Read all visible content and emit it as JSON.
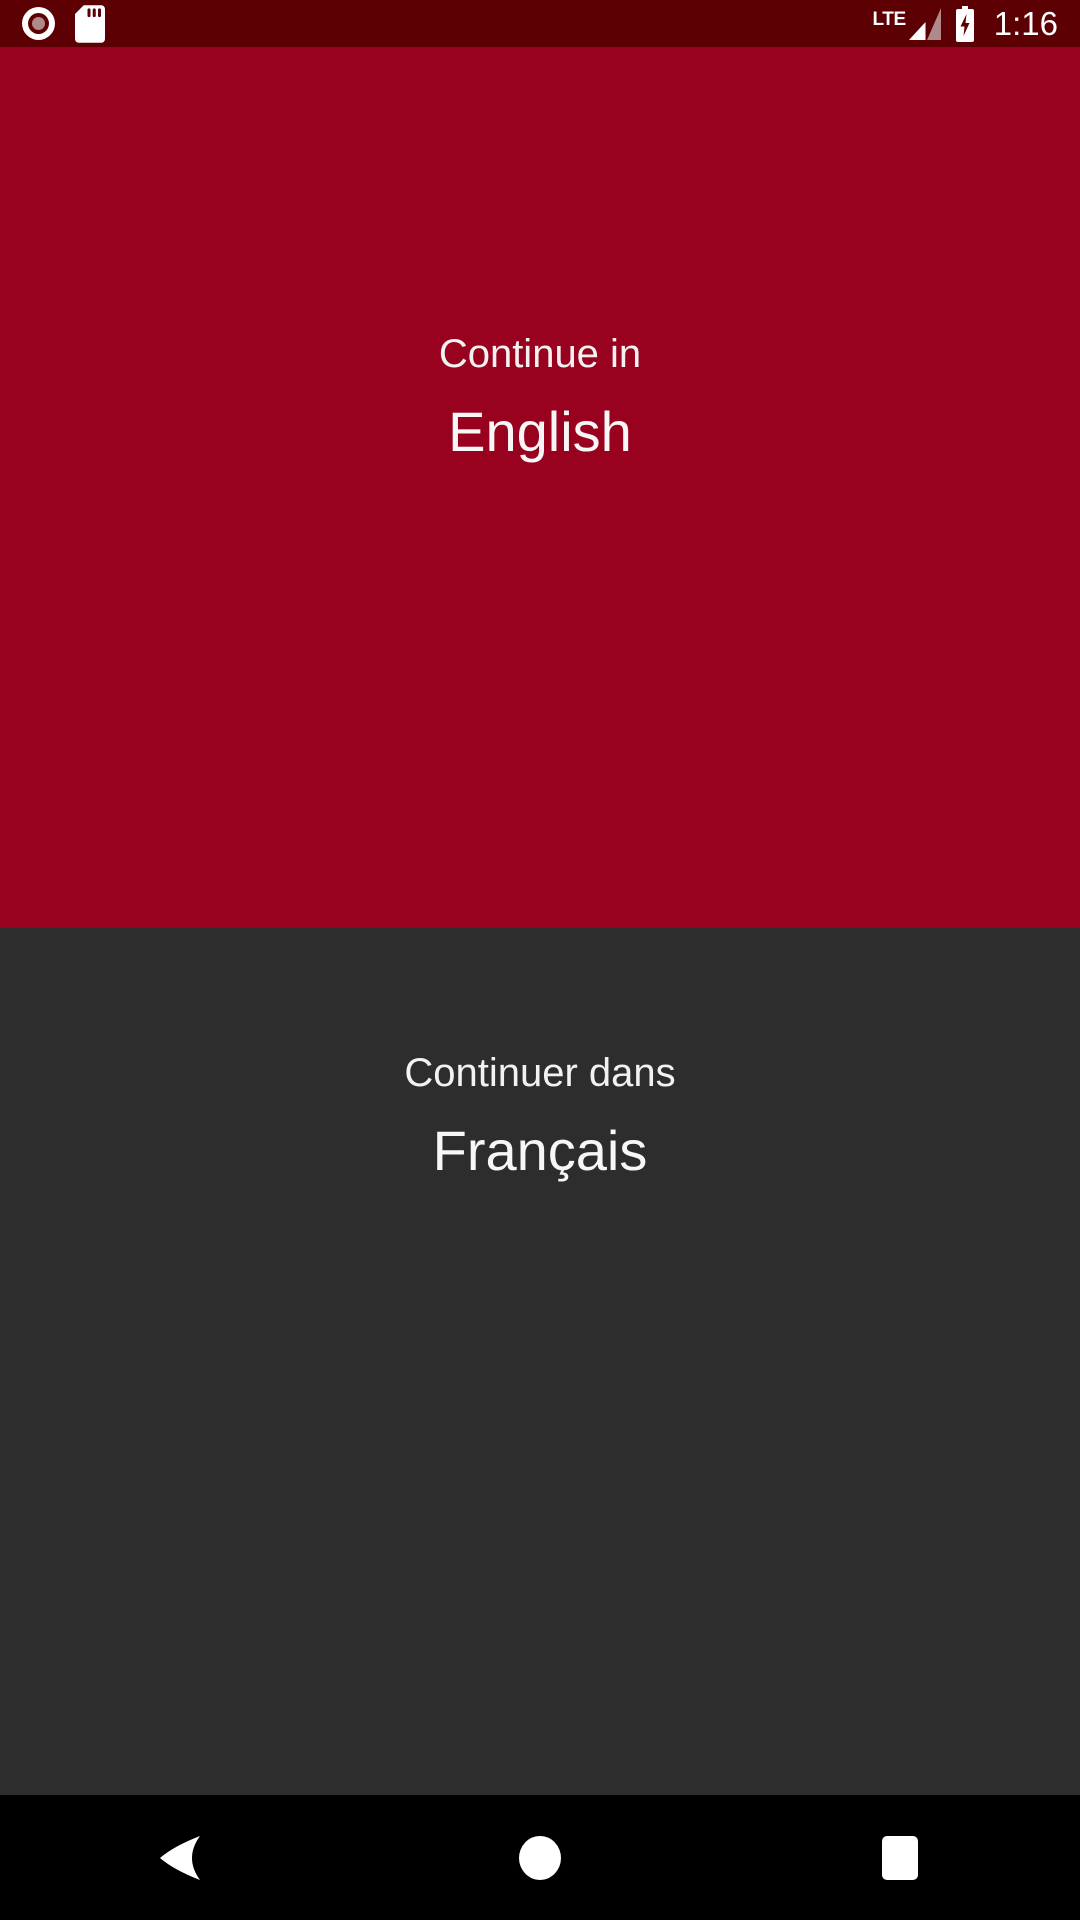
{
  "status_bar": {
    "background_color": "#5c0004",
    "left_icons": [
      {
        "name": "record-indicator-icon",
        "label": "record"
      },
      {
        "name": "sd-card-icon",
        "label": "sd-card"
      }
    ],
    "network_label": "LTE",
    "right_icons": [
      {
        "name": "signal-strength-icon",
        "label": "signal"
      },
      {
        "name": "battery-charging-icon",
        "label": "battery-charging"
      }
    ],
    "time": "1:16"
  },
  "language_chooser": {
    "options": [
      {
        "id": "english",
        "prefix": "Continue in",
        "name": "English",
        "background_color": "#99021f",
        "text_color": "#f7f7f7"
      },
      {
        "id": "french",
        "prefix": "Continuer dans",
        "name": "Français",
        "background_color": "#2d2d2d",
        "text_color": "#f7f7f7"
      }
    ]
  },
  "navigation_bar": {
    "background_color": "#000000",
    "buttons": [
      {
        "name": "nav-back-button",
        "label": "Back"
      },
      {
        "name": "nav-home-button",
        "label": "Home"
      },
      {
        "name": "nav-recents-button",
        "label": "Recents"
      }
    ]
  }
}
